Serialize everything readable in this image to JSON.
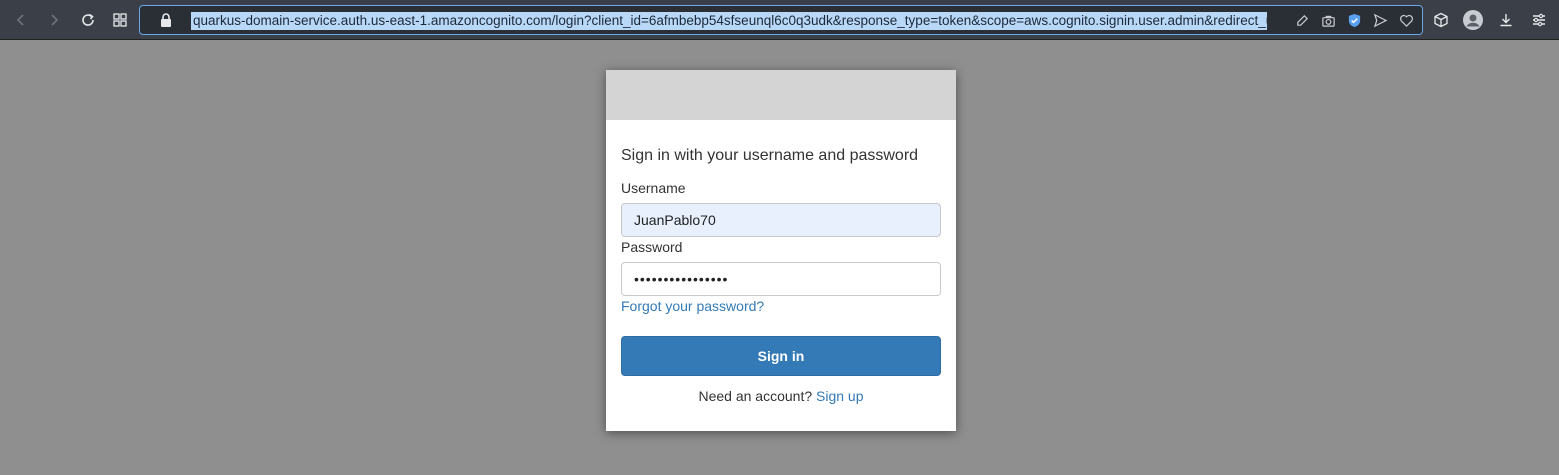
{
  "browser": {
    "url": "quarkus-domain-service.auth.us-east-1.amazoncognito.com/login?client_id=6afmbebp54sfseunql6c0q3udk&response_type=token&scope=aws.cognito.signin.user.admin&redirect_uri=http",
    "toolbar_icons": [
      "back-icon",
      "forward-icon",
      "reload-icon",
      "grid-icon",
      "lock-icon",
      "edit-icon",
      "camera-icon",
      "shield-icon",
      "send-icon",
      "heart-icon",
      "cube-icon",
      "profile-icon",
      "download-icon",
      "menu-icon"
    ],
    "accent_color": "#6aa6e8"
  },
  "login": {
    "heading": "Sign in with your username and password",
    "username_label": "Username",
    "username_value": "JuanPablo70",
    "password_label": "Password",
    "password_value": "••••••••••••••••",
    "forgot_link": "Forgot your password?",
    "signin_button": "Sign in",
    "need_account_text": "Need an account?",
    "signup_link": "Sign up",
    "button_color": "#337ab7"
  }
}
